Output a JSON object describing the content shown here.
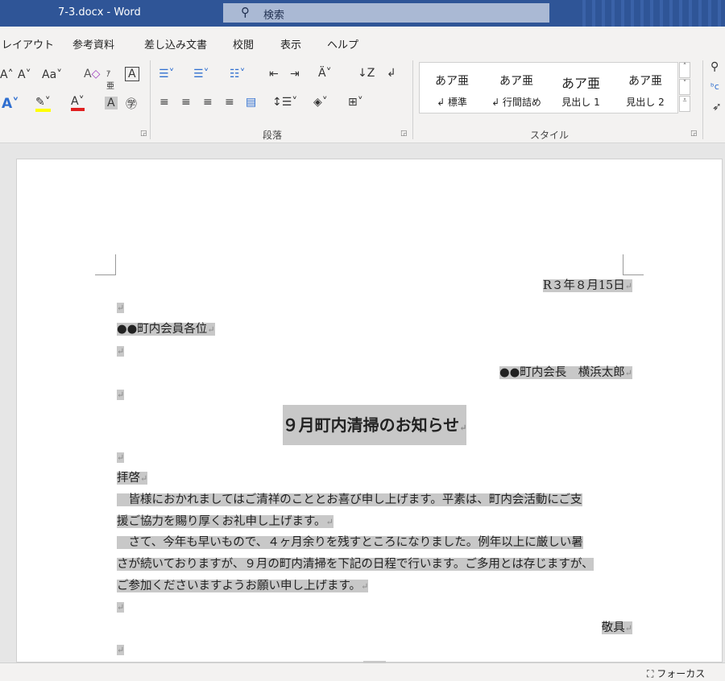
{
  "titlebar": {
    "document": "7-3.docx  -  Word",
    "search_placeholder": "検索"
  },
  "tabs": [
    "レイアウト",
    "参考資料",
    "差し込み文書",
    "校閲",
    "表示",
    "ヘルプ"
  ],
  "ribbon": {
    "groups": {
      "paragraph": "段落",
      "styles": "スタイル"
    },
    "styles": [
      {
        "preview": "あア亜",
        "name": "↲ 標準"
      },
      {
        "preview": "あア亜",
        "name": "↲ 行間詰め"
      },
      {
        "preview": "あア亜",
        "name": "見出し 1"
      },
      {
        "preview": "あア亜",
        "name": "見出し 2"
      }
    ],
    "font_case": "Aa",
    "highlight_color": "#ffff00",
    "font_color": "#e02020"
  },
  "document": {
    "date": "R３年８月15日",
    "recipient": "●●町内会員各位",
    "sender": "●●町内会長　横浜太郎",
    "title": "９月町内清掃のお知らせ",
    "opening": "拝啓",
    "body_lines": [
      "　皆様におかれましてはご清祥のこととお喜び申し上げます。平素は、町内会活動にご支",
      "援ご協力を賜り厚くお礼申し上げます。",
      "　さて、今年も早いもので、４ヶ月余りを残すところになりました。例年以上に厳しい暑",
      "さが続いておりますが、９月の町内清掃を下記の日程で行います。ご多用とは存じますが、",
      "ご参加くださいますようお願い申し上げます。"
    ],
    "closing": "敬具",
    "para_mark": "↵"
  },
  "status": {
    "focus": "フォーカス"
  }
}
